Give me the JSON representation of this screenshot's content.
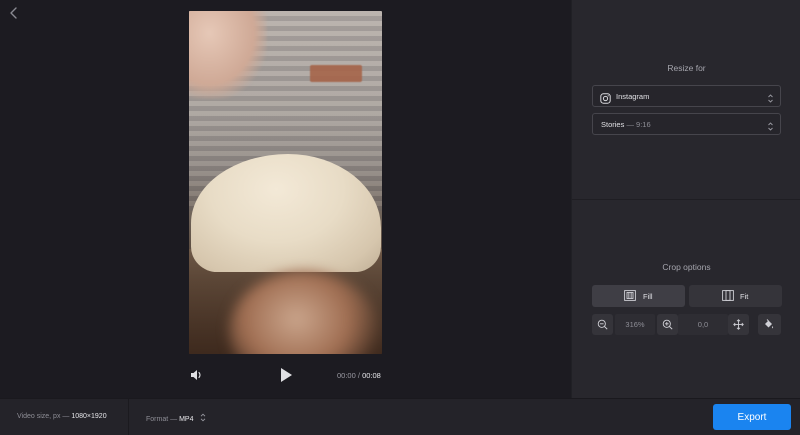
{
  "player": {
    "time_current": "00:00",
    "time_separator": "/",
    "time_total": "00:08"
  },
  "panel": {
    "resize_title": "Resize for",
    "platform_select": {
      "icon": "instagram-icon",
      "value": "Instagram"
    },
    "format_select": {
      "name": "Stories",
      "separator": "—",
      "ratio": "9:16"
    },
    "crop_title": "Crop options",
    "fill_label": "Fill",
    "fit_label": "Fit",
    "zoom_value": "316%",
    "position_value": "0,0"
  },
  "footer": {
    "video_size_label": "Video size, px —",
    "video_size_value": "1080×1920",
    "format_label": "Format —",
    "format_value": "MP4",
    "export_label": "Export"
  },
  "colors": {
    "accent": "#1a84f0",
    "background": "#1c1b21",
    "panel": "#28272d"
  }
}
